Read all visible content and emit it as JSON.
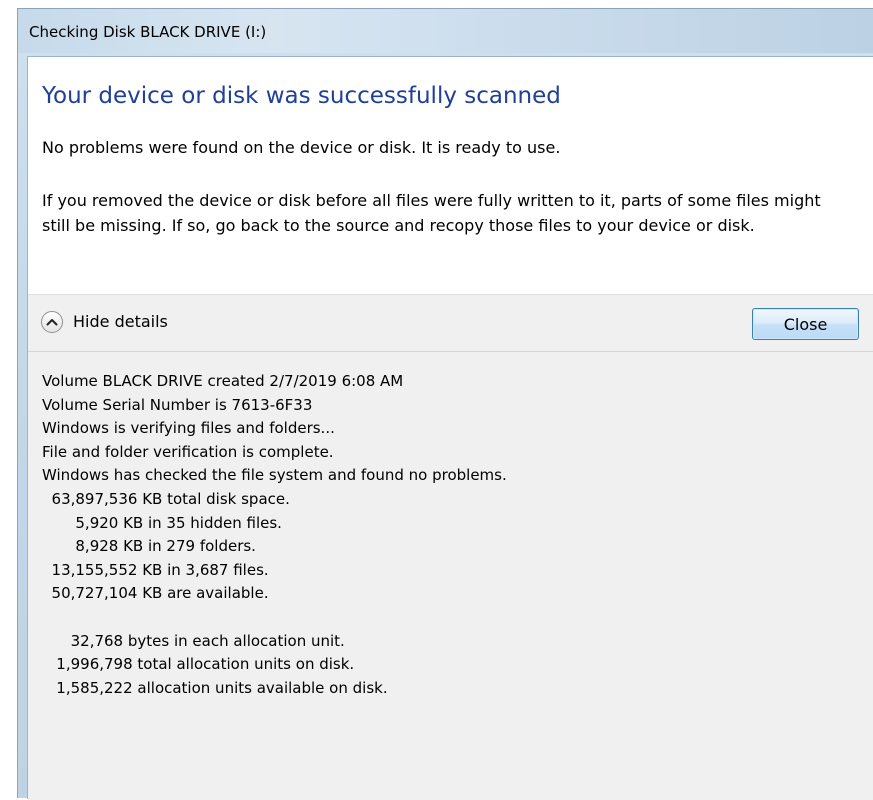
{
  "window": {
    "title": "Checking Disk BLACK DRIVE (I:)"
  },
  "dialog": {
    "main_instruction": "Your device or disk was successfully scanned",
    "message_1": "No problems were found on the device or disk. It is ready to use.",
    "message_2": "If you removed the device or disk before all files were fully written to it, parts of some files might still be missing. If so, go back to the source and recopy those files to your device or disk."
  },
  "controls": {
    "details_toggle_icon": "chevron-up-icon",
    "details_toggle_label": "Hide details",
    "close_label": "Close"
  },
  "details": {
    "lines": [
      "Volume BLACK DRIVE created 2/7/2019 6:08 AM",
      "Volume Serial Number is 7613-6F33",
      "Windows is verifying files and folders...",
      "File and folder verification is complete.",
      "Windows has checked the file system and found no problems.",
      "  63,897,536 KB total disk space.",
      "       5,920 KB in 35 hidden files.",
      "       8,928 KB in 279 folders.",
      "  13,155,552 KB in 3,687 files.",
      "  50,727,104 KB are available.",
      "",
      "      32,768 bytes in each allocation unit.",
      "   1,996,798 total allocation units on disk.",
      "   1,585,222 allocation units available on disk."
    ]
  }
}
